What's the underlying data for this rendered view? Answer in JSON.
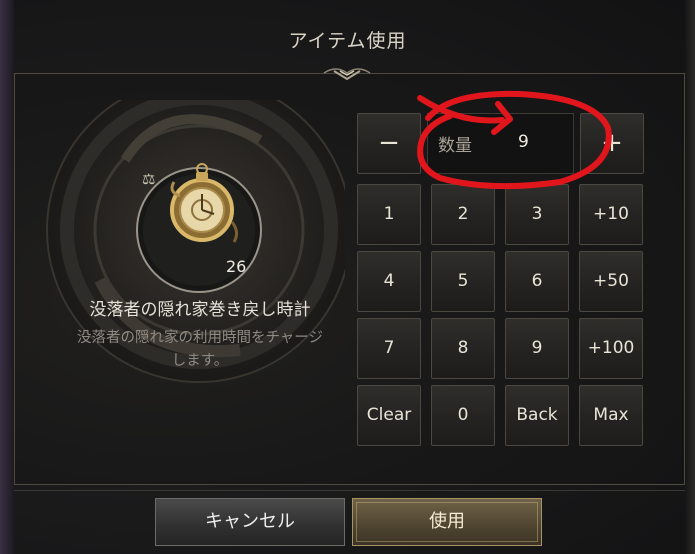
{
  "dialog": {
    "title": "アイテム使用"
  },
  "item": {
    "count": "26",
    "name": "没落者の隠れ家巻き戻し時計",
    "description_line1": "没落者の隠れ家の利用時間をチャージ",
    "description_line2": "します。",
    "type_icon": "scale-icon",
    "icon": "pocket-watch-icon"
  },
  "quantity": {
    "label": "数量",
    "value": "9"
  },
  "keypad": {
    "minus": "−",
    "plus": "+",
    "keys": [
      "1",
      "2",
      "3",
      "+10",
      "4",
      "5",
      "6",
      "+50",
      "7",
      "8",
      "9",
      "+100",
      "Clear",
      "0",
      "Back",
      "Max"
    ]
  },
  "buttons": {
    "cancel": "キャンセル",
    "use": "使用"
  },
  "annotation": {
    "color": "#e0161c",
    "shape": "hand-drawn-circle-with-arrow"
  },
  "colors": {
    "accent_gold": "#a89364",
    "text_light": "#e8e4d6"
  }
}
